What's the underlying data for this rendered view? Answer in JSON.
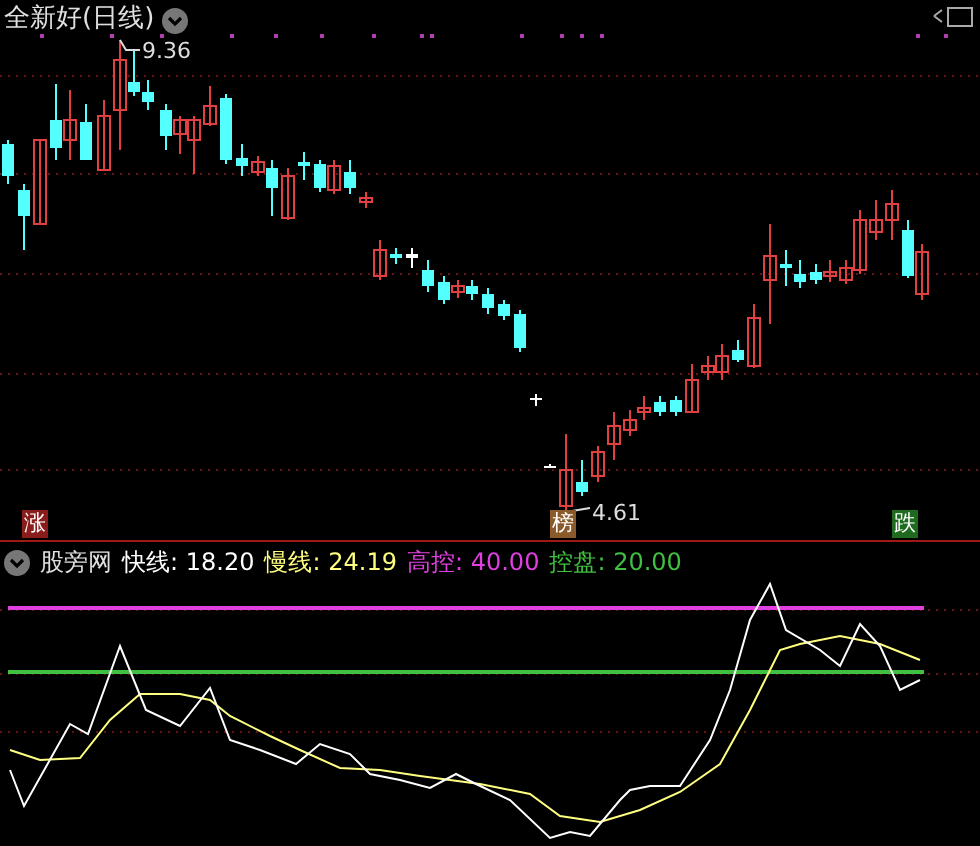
{
  "chart": {
    "title": "全新好(日线)",
    "high_label": "9.36",
    "low_label": "4.61",
    "signals": [
      {
        "label": "涨",
        "kind": "rise"
      },
      {
        "label": "榜",
        "kind": "list"
      },
      {
        "label": "跌",
        "kind": "fall"
      }
    ]
  },
  "indicator": {
    "name": "股旁网",
    "values": [
      {
        "label": "快线:",
        "value": "18.20",
        "color": "#ffffff"
      },
      {
        "label": "慢线:",
        "value": "24.19",
        "color": "#ffff80"
      },
      {
        "label": "高控:",
        "value": "40.00",
        "color": "#e040e0"
      },
      {
        "label": "控盘:",
        "value": "20.00",
        "color": "#40c040"
      }
    ]
  }
}
